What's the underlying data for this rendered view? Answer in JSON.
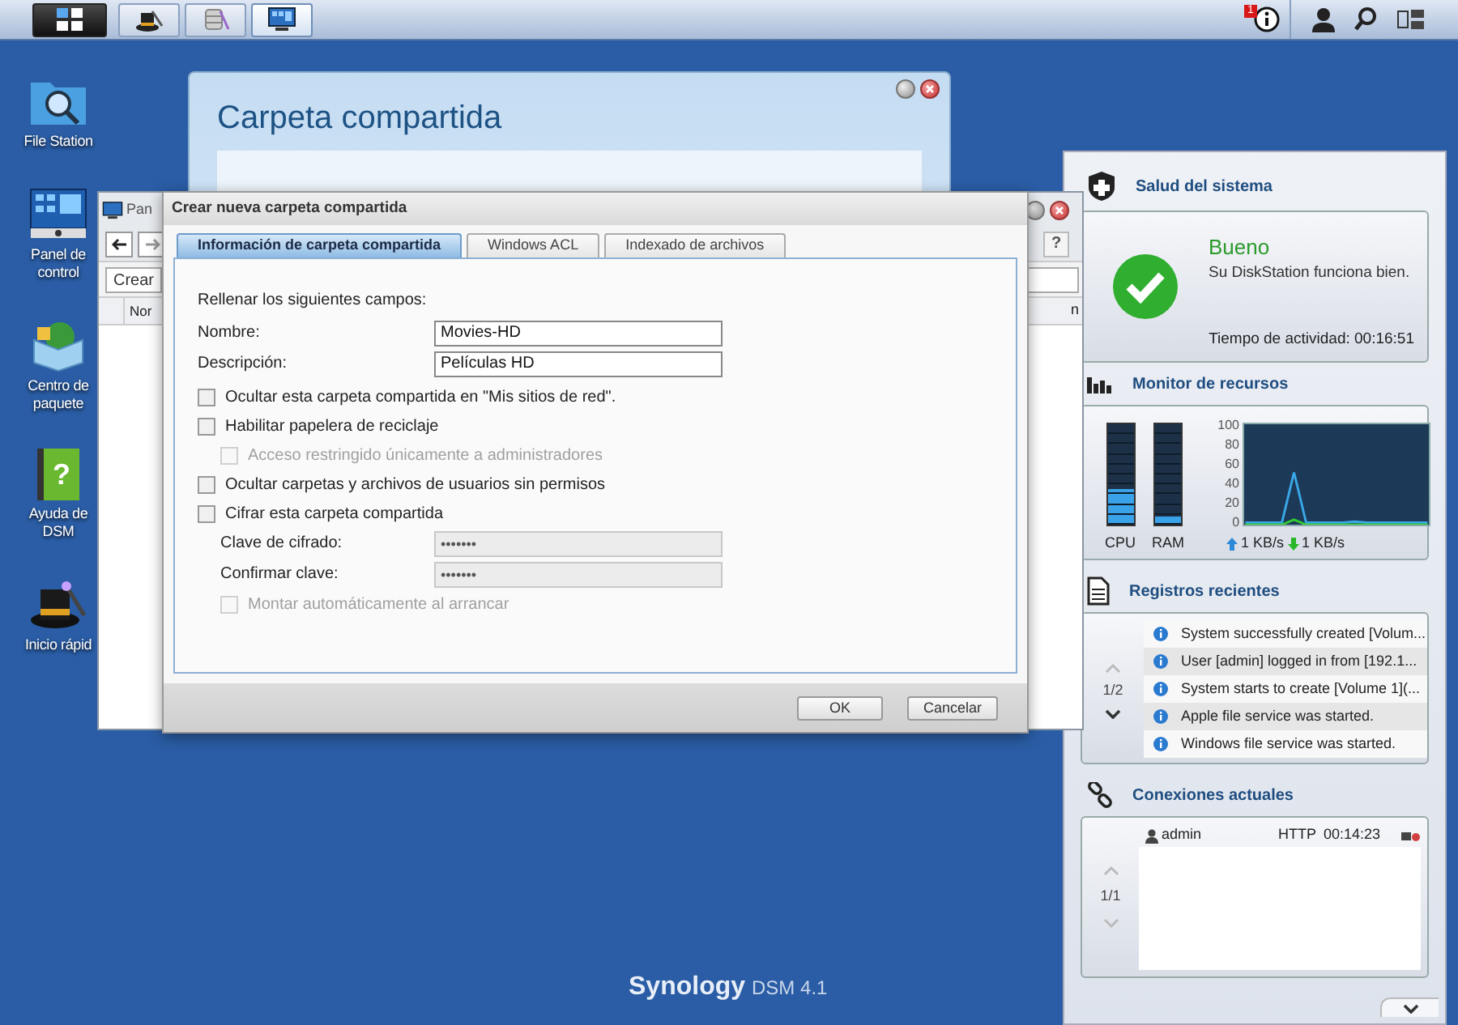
{
  "taskbar": {
    "buttons": [
      {
        "kind": "main-menu",
        "selected": false
      },
      {
        "kind": "quick-start",
        "selected": false
      },
      {
        "kind": "package-center",
        "selected": false
      },
      {
        "kind": "control-panel",
        "selected": true
      }
    ],
    "notification_count": "1"
  },
  "desktop_icons": [
    {
      "kind": "file-station",
      "label": "File Station"
    },
    {
      "kind": "control-panel",
      "label": "Panel de control"
    },
    {
      "kind": "package-center",
      "label": "Centro de paquete"
    },
    {
      "kind": "help",
      "label": "Ayuda de DSM",
      "glyph": "?"
    },
    {
      "kind": "quick-start",
      "label": "Inicio rápid"
    }
  ],
  "shared_folder_window": {
    "title": "Carpeta compartida"
  },
  "control_panel_window": {
    "title": "Pan",
    "create_button": "Crear",
    "help_button": "?",
    "columns": [
      "Nor",
      "n"
    ]
  },
  "dialog": {
    "title": "Crear nueva carpeta compartida",
    "tabs": [
      {
        "label": "Información de carpeta compartida",
        "selected": true
      },
      {
        "label": "Windows ACL",
        "selected": false
      },
      {
        "label": "Indexado de archivos",
        "selected": false
      }
    ],
    "intro": "Rellenar los siguientes campos:",
    "fields": [
      {
        "label": "Nombre:",
        "value": "Movies-HD"
      },
      {
        "label": "Descripción:",
        "value": "Películas HD"
      }
    ],
    "options": [
      {
        "kind": "checkbox",
        "label": "Ocultar esta carpeta compartida en \"Mis sitios de red\".",
        "checked": false,
        "disabled": false
      },
      {
        "kind": "checkbox",
        "label": "Habilitar papelera de reciclaje",
        "checked": false,
        "disabled": false,
        "children": [
          {
            "kind": "checkbox",
            "label": "Acceso restringido únicamente a administradores",
            "checked": false,
            "disabled": true
          }
        ]
      },
      {
        "kind": "checkbox",
        "label": "Ocultar carpetas y archivos de usuarios sin permisos",
        "checked": false,
        "disabled": false
      },
      {
        "kind": "checkbox",
        "label": "Cifrar esta carpeta compartida",
        "checked": false,
        "disabled": false,
        "children": [
          {
            "kind": "password",
            "label": "Clave de cifrado:",
            "value": "•••••••",
            "disabled": true
          },
          {
            "kind": "password",
            "label": "Confirmar clave:",
            "value": "•••••••",
            "disabled": true
          },
          {
            "kind": "checkbox",
            "label": "Montar automáticamente al arrancar",
            "checked": false,
            "disabled": true
          }
        ]
      }
    ],
    "buttons": [
      "OK",
      "Cancelar"
    ]
  },
  "widgets": {
    "health": {
      "title": "Salud del sistema",
      "status": "Bueno",
      "message": "Su DiskStation funciona bien.",
      "uptime": "Tiempo de actividad: 00:16:51"
    },
    "resources": {
      "title": "Monitor de recursos",
      "meters": [
        {
          "label": "CPU",
          "level": 0.35
        },
        {
          "label": "RAM",
          "level": 0.08
        }
      ],
      "upload": "1 KB/s",
      "download": "1 KB/s",
      "chart_data": {
        "type": "line",
        "yticks": [
          0,
          20,
          40,
          60,
          80,
          100
        ],
        "ylim": [
          0,
          100
        ],
        "series": [
          {
            "color": "#3aa8e8",
            "values": [
              2,
              2,
              2,
              2,
              52,
              2,
              2,
              2,
              2,
              3,
              2,
              2,
              2,
              2,
              2,
              2
            ]
          },
          {
            "color": "#33cc33",
            "values": [
              0,
              0,
              0,
              0,
              5,
              0,
              0,
              0,
              0,
              0,
              0,
              0,
              0,
              0,
              0,
              0
            ]
          }
        ]
      }
    },
    "logs": {
      "title": "Registros recientes",
      "pager": "1/2",
      "items": [
        "System successfully created [Volum...",
        "User [admin] logged in from [192.1...",
        "System starts to create [Volume 1](...",
        "Apple file service was started.",
        "Windows file service was started."
      ]
    },
    "connections": {
      "title": "Conexiones actuales",
      "pager": "1/1",
      "rows": [
        {
          "user": "admin",
          "protocol": "HTTP",
          "time": "00:14:23"
        }
      ]
    }
  },
  "branding": {
    "brand": "Synology",
    "version": "DSM 4.1"
  }
}
